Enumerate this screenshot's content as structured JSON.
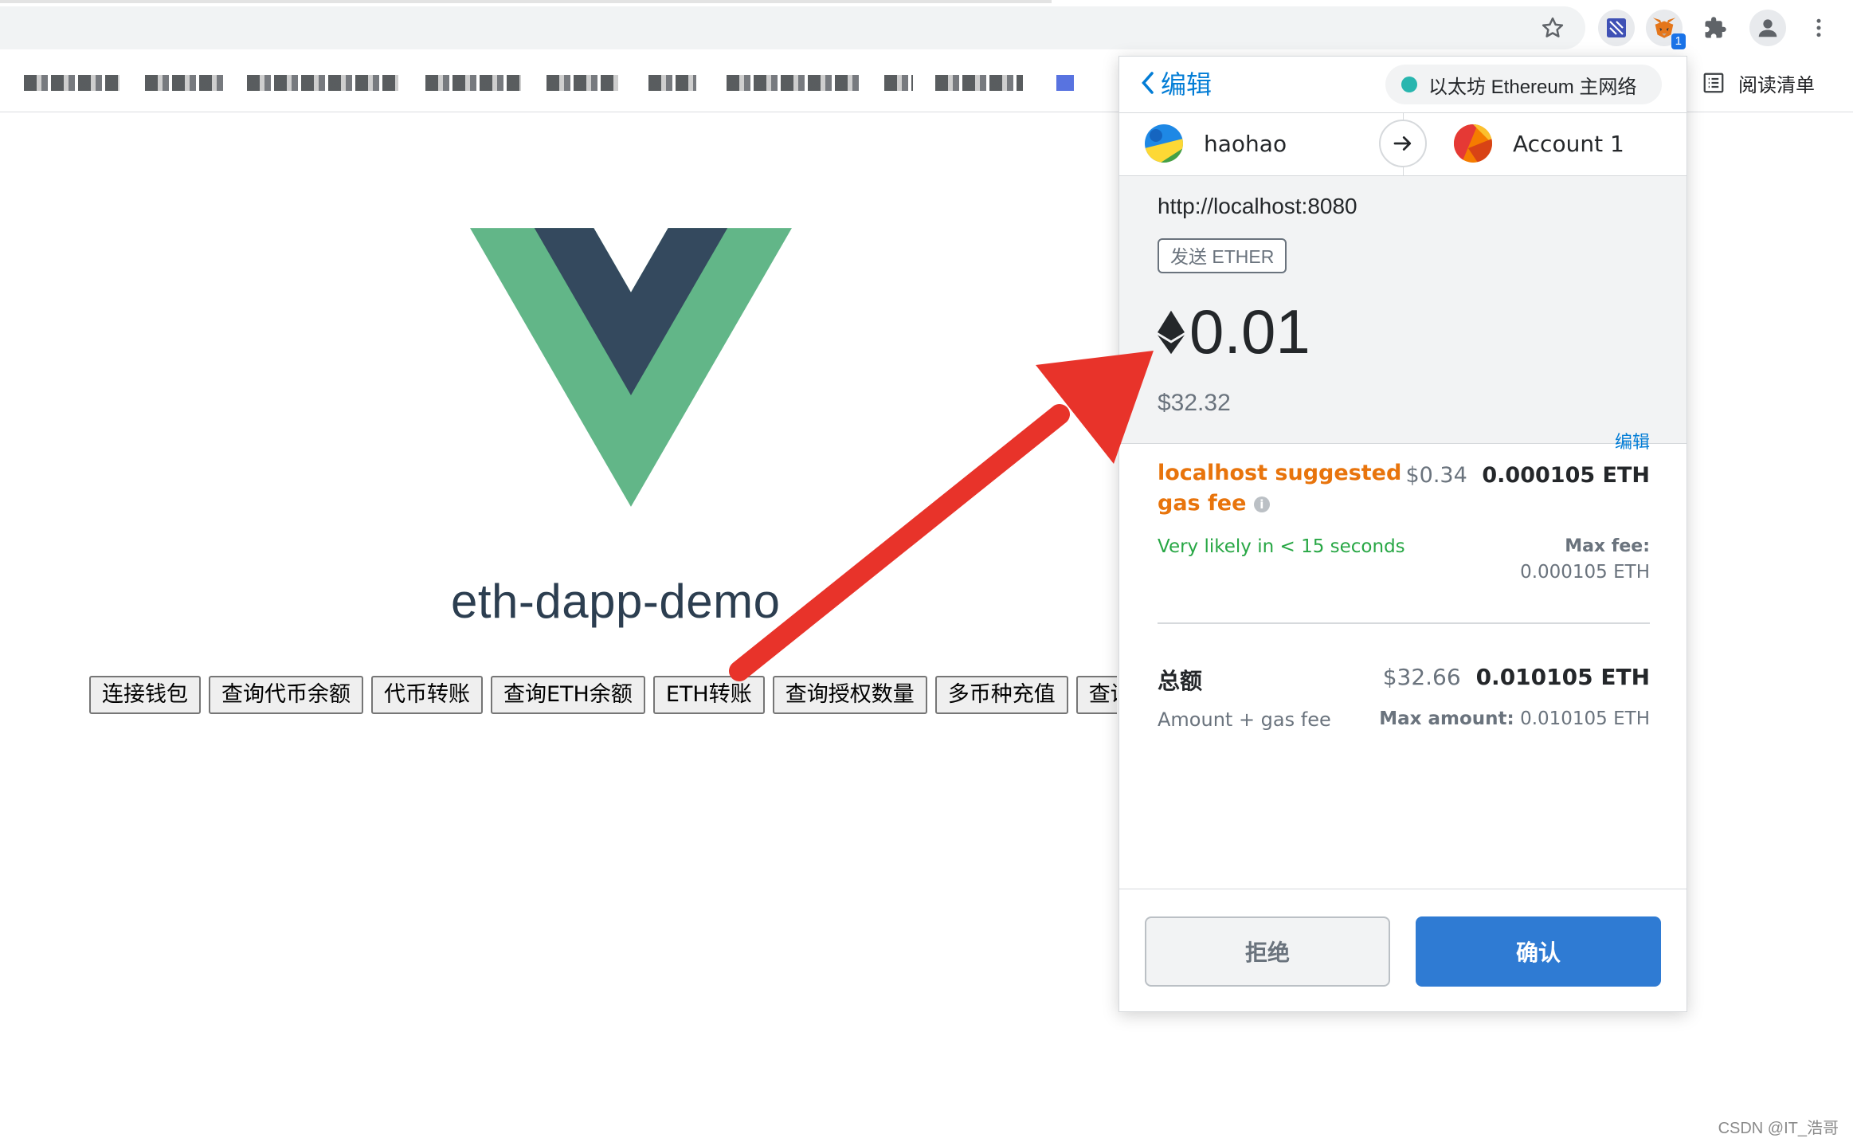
{
  "browser": {
    "extension_badge": "1",
    "reading_list_label": "阅读清单",
    "icons": [
      "star-icon",
      "rabby-icon",
      "metamask-fox-icon",
      "puzzle-icon",
      "profile-icon",
      "kebab-menu-icon",
      "reading-list-icon"
    ]
  },
  "page": {
    "title": "eth-dapp-demo",
    "buttons": [
      "连接钱包",
      "查询代币余额",
      "代币转账",
      "查询ETH余额",
      "ETH转账",
      "查询授权数量",
      "多币种充值",
      "查询"
    ]
  },
  "metamask": {
    "back_label": "编辑",
    "network": "以太坊 Ethereum 主网络",
    "from_account": "haohao",
    "to_account": "Account 1",
    "origin": "http://localhost:8080",
    "method": "发送 ETHER",
    "amount": "0.01",
    "amount_fiat": "$32.32",
    "edit_label": "编辑",
    "gas_label": "localhost suggested gas fee",
    "gas_fiat": "$0.34",
    "gas_eth": "0.000105 ETH",
    "likely_text": "Very likely in < 15 seconds",
    "max_fee_label": "Max fee:",
    "max_fee_value": "0.000105 ETH",
    "total_label": "总额",
    "total_fiat": "$32.66",
    "total_eth": "0.010105 ETH",
    "amount_gas_label": "Amount + gas fee",
    "max_amount_label": "Max amount:",
    "max_amount_value": "0.010105 ETH",
    "reject_label": "拒绝",
    "confirm_label": "确认"
  },
  "watermark": "CSDN @IT_浩哥",
  "colors": {
    "accent": "#037dd6",
    "confirm": "#2f7bd3",
    "gas_warning": "#e8740c",
    "success": "#28a745",
    "annotation_arrow": "#e8332a",
    "vue_green": "#41b883",
    "vue_dark": "#34495e"
  }
}
